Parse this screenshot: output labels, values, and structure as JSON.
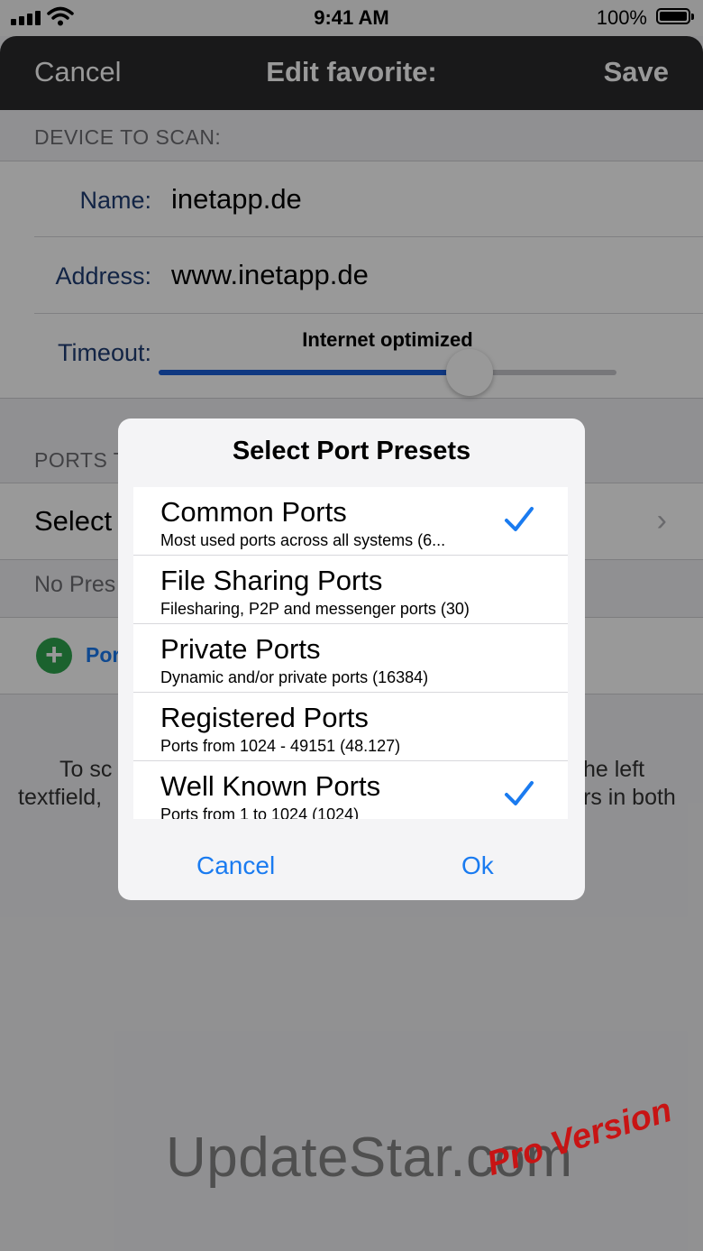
{
  "status_bar": {
    "time": "9:41 AM",
    "battery": "100%"
  },
  "nav": {
    "cancel": "Cancel",
    "title": "Edit favorite:",
    "save": "Save"
  },
  "device_section": {
    "header": "DEVICE TO SCAN:",
    "name_label": "Name:",
    "name_value": "inetapp.de",
    "address_label": "Address:",
    "address_value": "www.inetapp.de",
    "timeout_label": "Timeout:",
    "timeout_caption": "Internet optimized",
    "timeout_level": 0.68
  },
  "ports_section": {
    "header": "PORTS T",
    "select_label": "Select",
    "no_preset": "No Pres",
    "add_label": "Por"
  },
  "help": {
    "line1_left": "To sc",
    "line1_right": "he left",
    "line2_left": "textfield,",
    "line2_right": "rs in both"
  },
  "dialog": {
    "title": "Select Port Presets",
    "presets": [
      {
        "title": "Common Ports",
        "subtitle": "Most used ports across all systems (6...",
        "checked": true
      },
      {
        "title": "File Sharing Ports",
        "subtitle": "Filesharing, P2P and messenger ports (30)",
        "checked": false
      },
      {
        "title": "Private Ports",
        "subtitle": "Dynamic and/or private ports (16384)",
        "checked": false
      },
      {
        "title": "Registered Ports",
        "subtitle": "Ports from 1024 - 49151 (48.127)",
        "checked": false
      },
      {
        "title": "Well Known Ports",
        "subtitle": "Ports from 1 to 1024 (1024)",
        "checked": true
      }
    ],
    "cancel": "Cancel",
    "ok": "Ok"
  },
  "watermark": {
    "site": "UpdateStar.com",
    "tag": "Pro Version"
  },
  "colors": {
    "accent": "#1a7bf0",
    "slider": "#1a5ed8",
    "add": "#2da44e",
    "watermark_tag": "#c81414"
  }
}
